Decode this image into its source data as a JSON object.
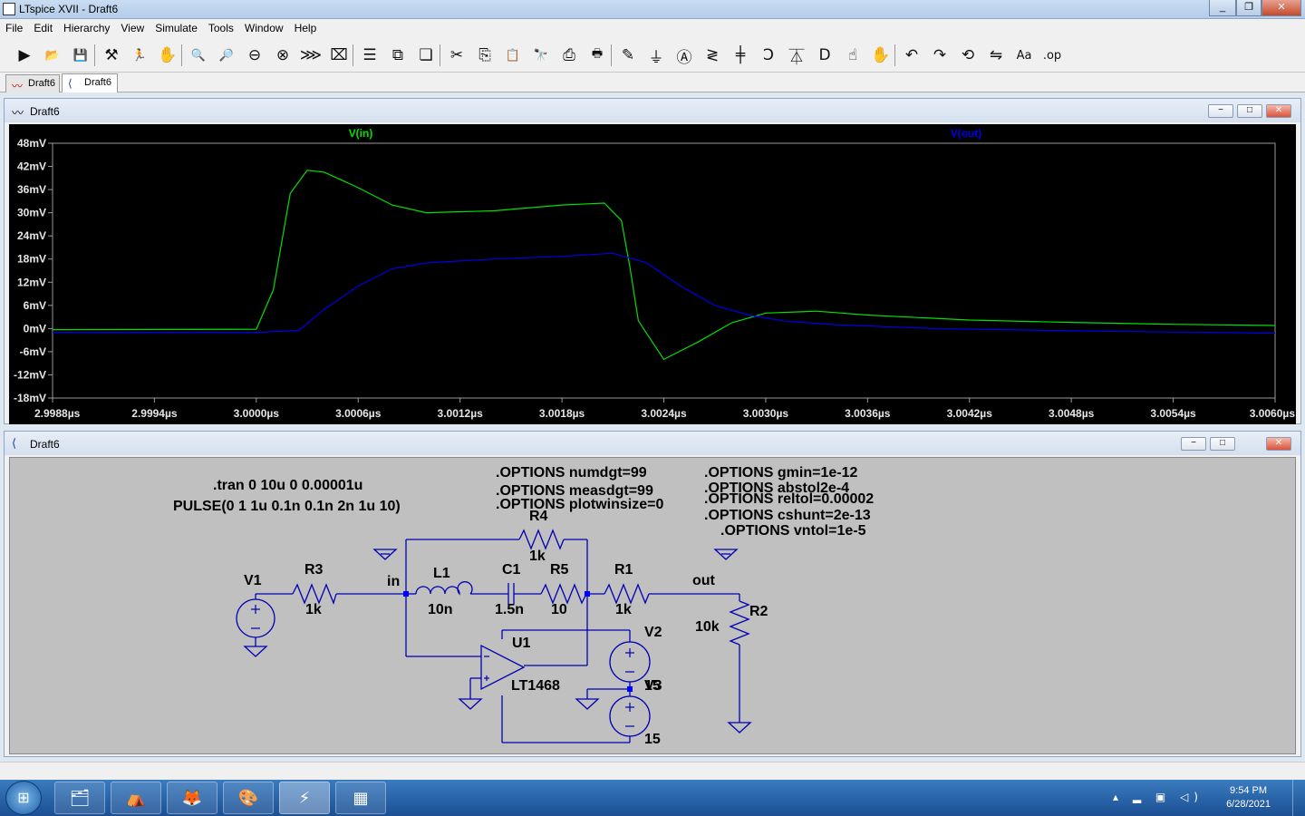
{
  "window": {
    "title": "LTspice XVII - Draft6",
    "controls": [
      "_",
      "❐",
      "✕"
    ]
  },
  "menu": [
    "File",
    "Edit",
    "Hierarchy",
    "View",
    "Simulate",
    "Tools",
    "Window",
    "Help"
  ],
  "toolbar": [
    {
      "name": "run-icon",
      "glyph": "▶"
    },
    {
      "name": "open-icon",
      "glyph": "📂"
    },
    {
      "name": "save-icon",
      "glyph": "💾"
    },
    {
      "name": "control-panel-icon",
      "glyph": "⚒"
    },
    {
      "name": "run-halt-icon",
      "glyph": "🏃"
    },
    {
      "name": "pan-icon",
      "glyph": "✋"
    },
    {
      "name": "zoom-in-icon",
      "glyph": "🔍"
    },
    {
      "name": "zoom-full-icon",
      "glyph": "🔎"
    },
    {
      "name": "zoom-out-icon",
      "glyph": "⊖"
    },
    {
      "name": "zoom-cancel-icon",
      "glyph": "⊗"
    },
    {
      "name": "autorange-icon",
      "glyph": "⋙"
    },
    {
      "name": "delete-trace-icon",
      "glyph": "⌧"
    },
    {
      "name": "tile-horizontal-icon",
      "glyph": "☰"
    },
    {
      "name": "tile-vertical-icon",
      "glyph": "⧉"
    },
    {
      "name": "cascade-icon",
      "glyph": "❏"
    },
    {
      "name": "cut-icon",
      "glyph": "✂"
    },
    {
      "name": "copy-icon",
      "glyph": "⎘"
    },
    {
      "name": "paste-icon",
      "glyph": "📋"
    },
    {
      "name": "find-icon",
      "glyph": "🔭"
    },
    {
      "name": "print-preview-icon",
      "glyph": "⎙"
    },
    {
      "name": "print-icon",
      "glyph": "🖶"
    },
    {
      "name": "draw-wire-icon",
      "glyph": "✎"
    },
    {
      "name": "ground-icon",
      "glyph": "⏚"
    },
    {
      "name": "label-net-icon",
      "glyph": "Ⓐ"
    },
    {
      "name": "resistor-icon",
      "glyph": "≷"
    },
    {
      "name": "capacitor-icon",
      "glyph": "╪"
    },
    {
      "name": "inductor-icon",
      "glyph": "Ↄ"
    },
    {
      "name": "diode-icon",
      "glyph": "⏄"
    },
    {
      "name": "component-icon",
      "glyph": "D"
    },
    {
      "name": "move-icon",
      "glyph": "☝"
    },
    {
      "name": "drag-icon",
      "glyph": "✋"
    },
    {
      "name": "undo-icon",
      "glyph": "↶"
    },
    {
      "name": "redo-icon",
      "glyph": "↷"
    },
    {
      "name": "rotate-icon",
      "glyph": "⟲"
    },
    {
      "name": "mirror-icon",
      "glyph": "⇋"
    },
    {
      "name": "text-icon",
      "glyph": "Aa"
    },
    {
      "name": "spice-directive-icon",
      "glyph": ".op"
    }
  ],
  "tabs": [
    {
      "label": "Draft6",
      "icon": "waveform-icon"
    },
    {
      "label": "Draft6",
      "icon": "schematic-icon",
      "active": true
    }
  ],
  "waveform_window": {
    "title": "Draft6",
    "controls": [
      "−",
      "□",
      "✕"
    ],
    "chart_data": {
      "type": "line",
      "xlabel": "",
      "ylabel": "",
      "xlim": [
        2.9988,
        3.006
      ],
      "ylim": [
        -18,
        48
      ],
      "x_tick_labels": [
        "2.9988µs",
        "2.9994µs",
        "3.0000µs",
        "3.0006µs",
        "3.0012µs",
        "3.0018µs",
        "3.0024µs",
        "3.0030µs",
        "3.0036µs",
        "3.0042µs",
        "3.0048µs",
        "3.0054µs",
        "3.0060µs"
      ],
      "y_tick_labels": [
        "48mV",
        "42mV",
        "36mV",
        "30mV",
        "24mV",
        "18mV",
        "12mV",
        "6mV",
        "0mV",
        "-6mV",
        "-12mV",
        "-18mV"
      ],
      "grid": false,
      "series": [
        {
          "name": "V(in)",
          "color": "#00e000",
          "x": [
            2.9988,
            3.0,
            3.0001,
            3.0002,
            3.0003,
            3.0004,
            3.0006,
            3.0008,
            3.001,
            3.0014,
            3.0018,
            3.00205,
            3.00215,
            3.0022,
            3.00225,
            3.0024,
            3.0026,
            3.0028,
            3.003,
            3.0033,
            3.0036,
            3.0042,
            3.0048,
            3.0054,
            3.006
          ],
          "y": [
            -0.3,
            -0.2,
            10.0,
            35.0,
            41.0,
            40.5,
            36.5,
            32.0,
            30.0,
            30.5,
            32.0,
            32.5,
            28.0,
            16.0,
            2.0,
            -8.0,
            -3.5,
            1.5,
            4.0,
            4.5,
            3.5,
            2.2,
            1.6,
            1.1,
            0.8
          ]
        },
        {
          "name": "V(out)",
          "color": "#0000e8",
          "x": [
            2.9988,
            3.0,
            3.00025,
            3.0004,
            3.0006,
            3.0008,
            3.001,
            3.0014,
            3.0018,
            3.0021,
            3.0023,
            3.0025,
            3.0027,
            3.0029,
            3.0031,
            3.0034,
            3.004,
            3.0048,
            3.006
          ],
          "y": [
            -1.0,
            -1.0,
            -0.5,
            5.0,
            11.0,
            15.5,
            17.0,
            18.0,
            18.7,
            19.5,
            17.0,
            11.0,
            6.0,
            3.5,
            2.0,
            1.0,
            0.0,
            -0.6,
            -1.2
          ]
        }
      ]
    }
  },
  "schematic_window": {
    "title": "Draft6",
    "controls": [
      "−",
      "□",
      "✕"
    ],
    "directives": {
      "tran": ".tran 0 10u 0 0.00001u",
      "pulse": "PULSE(0 1 1u 0.1n 0.1n 2n 1u 10)",
      "numdgt": ".OPTIONS numdgt=99",
      "measdgt": ".OPTIONS measdgt=99",
      "plotwinsize": ".OPTIONS plotwinsize=0",
      "gmin": ".OPTIONS gmin=1e-12",
      "abstol": ".OPTIONS abstol2e-4",
      "reltol": ".OPTIONS reltol=0.00002",
      "cshunt": ".OPTIONS cshunt=2e-13",
      "vntol": ".OPTIONS vntol=1e-5"
    },
    "components": {
      "v1": "V1",
      "r3": "R3",
      "r3_val": "1k",
      "r4": "R4",
      "r4_val": "1k",
      "l1": "L1",
      "l1_val": "10n",
      "c1": "C1",
      "c1_val": "1.5n",
      "r5": "R5",
      "r5_val": "10",
      "r1": "R1",
      "r1_val": "1k",
      "r2": "R2",
      "r2_val": "10k",
      "u1": "U1",
      "u1_val": "LT1468",
      "v2": "V2",
      "v3": "V3",
      "v3_val": "15",
      "v2_val_overlap": "15"
    },
    "nets": {
      "in": "in",
      "out": "out"
    }
  },
  "taskbar": {
    "apps": [
      {
        "name": "explorer-icon",
        "glyph": "🗂"
      },
      {
        "name": "acrobat-icon",
        "glyph": "⛺"
      },
      {
        "name": "firefox-icon",
        "glyph": "🦊"
      },
      {
        "name": "paint-icon",
        "glyph": "🎨"
      },
      {
        "name": "ltspice-icon",
        "glyph": "⚡",
        "active": true
      },
      {
        "name": "calculator-icon",
        "glyph": "▦"
      }
    ],
    "tray_icons": "▴ ▂ ▣ ◁)",
    "time": "9:54 PM",
    "date": "6/28/2021"
  }
}
